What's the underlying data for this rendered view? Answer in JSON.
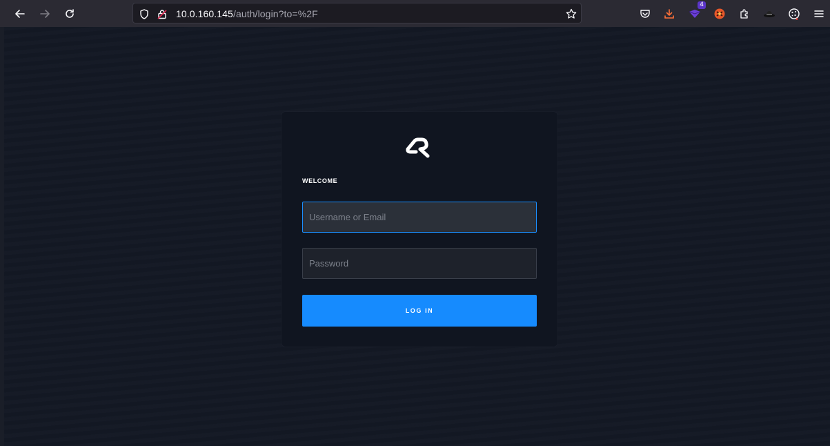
{
  "browser": {
    "url_host": "10.0.160.145",
    "url_path": "/auth/login?to=%2F",
    "extension_badge": "4",
    "icons": [
      "back-icon",
      "forward-icon",
      "reload-icon",
      "shield-icon",
      "insecure-lock-icon",
      "bookmark-star-icon",
      "pocket-icon",
      "download-icon",
      "extension-purple-icon",
      "extension-orange-icon",
      "extensions-puzzle-icon",
      "hat-icon",
      "cookie-icon",
      "menu-icon"
    ]
  },
  "login": {
    "welcome": "WELCOME",
    "username_placeholder": "Username or Email",
    "password_placeholder": "Password",
    "login_label": "LOG IN"
  },
  "colors": {
    "accent": "#168bfe",
    "background": "#131824",
    "card": "#101520",
    "toolbar": "#2b2a33"
  }
}
